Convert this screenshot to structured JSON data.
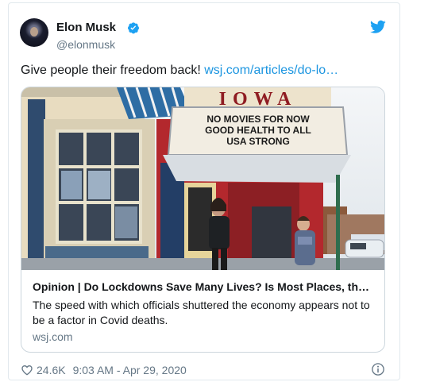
{
  "author": {
    "name": "Elon Musk",
    "handle": "@elonmusk"
  },
  "tweet": {
    "text": "Give people their freedom back!",
    "link": "wsj.com/articles/do-lo…"
  },
  "card": {
    "marquee_brand": "IOWA",
    "marquee_lines": [
      "NO MOVIES FOR NOW",
      "GOOD HEALTH TO ALL",
      "USA STRONG"
    ],
    "title": "Opinion | Do Lockdowns Save Many Lives? Is Most Places, th…",
    "description": "The speed with which officials shuttered the economy appears not to be a factor in Covid deaths.",
    "domain": "wsj.com"
  },
  "footer": {
    "likes": "24.6K",
    "timestamp": "9:03 AM - Apr 29, 2020"
  },
  "colors": {
    "accent": "#1b95e0",
    "verified": "#1da1f2",
    "text": "#14171a",
    "muted": "#657786"
  },
  "icons": {
    "verified": "verified-badge-icon",
    "brand": "twitter-bird-icon",
    "like": "heart-icon",
    "info": "info-icon"
  }
}
